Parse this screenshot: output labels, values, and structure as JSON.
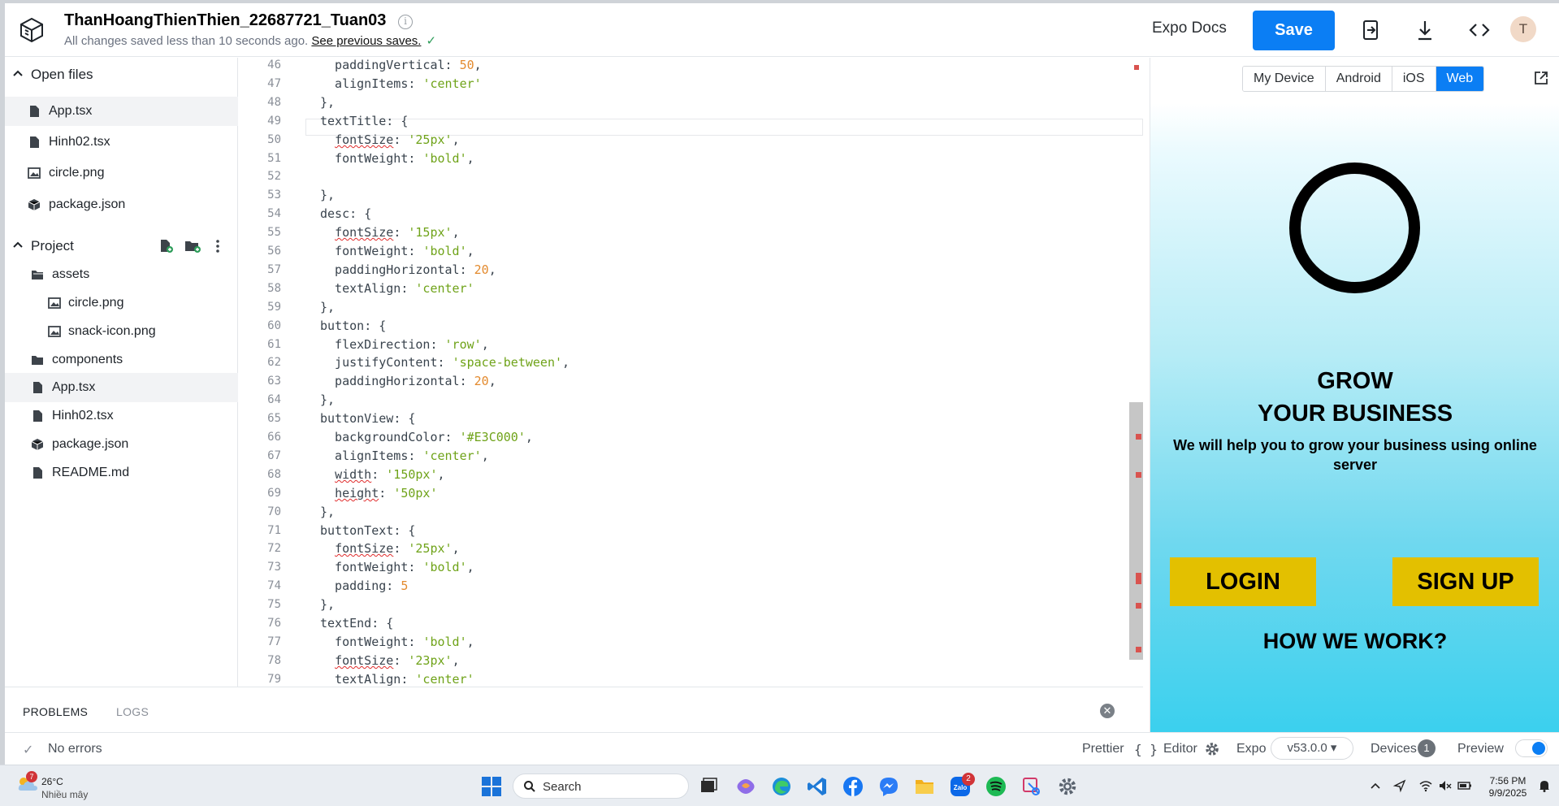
{
  "header": {
    "project_title": "ThanHoangThienThien_22687721_Tuan03",
    "saved_status": "All changes saved less than 10 seconds ago.",
    "previous_saves_link": "See previous saves.",
    "docs_label": "Expo Docs",
    "save_label": "Save",
    "avatar_initial": "T"
  },
  "sidebar": {
    "open_files_label": "Open files",
    "open_files": [
      {
        "name": "App.tsx",
        "icon": "file-icon",
        "active": true
      },
      {
        "name": "Hinh02.tsx",
        "icon": "file-icon"
      },
      {
        "name": "circle.png",
        "icon": "image-icon"
      },
      {
        "name": "package.json",
        "icon": "package-icon"
      }
    ],
    "project_label": "Project",
    "project_tree": [
      {
        "name": "assets",
        "icon": "folder-open-icon"
      },
      {
        "name": "circle.png",
        "icon": "image-icon"
      },
      {
        "name": "snack-icon.png",
        "icon": "image-icon"
      },
      {
        "name": "components",
        "icon": "folder-icon"
      },
      {
        "name": "App.tsx",
        "icon": "file-icon",
        "active": true
      },
      {
        "name": "Hinh02.tsx",
        "icon": "file-icon"
      },
      {
        "name": "package.json",
        "icon": "package-icon"
      },
      {
        "name": "README.md",
        "icon": "file-icon"
      }
    ]
  },
  "editor": {
    "lines": [
      {
        "n": "46",
        "k": "  paddingVertical",
        "v": "50",
        "t": "num",
        "e": ","
      },
      {
        "n": "47",
        "k": "  alignItems",
        "v": "'center'",
        "t": "str",
        "e": ""
      },
      {
        "n": "48",
        "k": "}",
        "v": "",
        "t": "",
        "e": ","
      },
      {
        "n": "49",
        "k": "textTitle",
        "v": "{",
        "t": "",
        "e": ""
      },
      {
        "n": "50",
        "k": "  fontSize",
        "v": "'25px'",
        "t": "str",
        "e": ",",
        "sq": true
      },
      {
        "n": "51",
        "k": "  fontWeight",
        "v": "'bold'",
        "t": "str",
        "e": ","
      },
      {
        "n": "52",
        "k": "",
        "v": "",
        "t": "",
        "e": ""
      },
      {
        "n": "53",
        "k": "}",
        "v": "",
        "t": "",
        "e": ","
      },
      {
        "n": "54",
        "k": "desc",
        "v": "{",
        "t": "",
        "e": ""
      },
      {
        "n": "55",
        "k": "  fontSize",
        "v": "'15px'",
        "t": "str",
        "e": ",",
        "sq": true
      },
      {
        "n": "56",
        "k": "  fontWeight",
        "v": "'bold'",
        "t": "str",
        "e": ","
      },
      {
        "n": "57",
        "k": "  paddingHorizontal",
        "v": "20",
        "t": "num",
        "e": ","
      },
      {
        "n": "58",
        "k": "  textAlign",
        "v": "'center'",
        "t": "str",
        "e": ""
      },
      {
        "n": "59",
        "k": "}",
        "v": "",
        "t": "",
        "e": ","
      },
      {
        "n": "60",
        "k": "button",
        "v": "{",
        "t": "",
        "e": ""
      },
      {
        "n": "61",
        "k": "  flexDirection",
        "v": "'row'",
        "t": "str",
        "e": ","
      },
      {
        "n": "62",
        "k": "  justifyContent",
        "v": "'space-between'",
        "t": "str",
        "e": ","
      },
      {
        "n": "63",
        "k": "  paddingHorizontal",
        "v": "20",
        "t": "num",
        "e": ","
      },
      {
        "n": "64",
        "k": "}",
        "v": "",
        "t": "",
        "e": ","
      },
      {
        "n": "65",
        "k": "buttonView",
        "v": "{",
        "t": "",
        "e": ""
      },
      {
        "n": "66",
        "k": "  backgroundColor",
        "v": "'#E3C000'",
        "t": "str",
        "e": ","
      },
      {
        "n": "67",
        "k": "  alignItems",
        "v": "'center'",
        "t": "str",
        "e": ","
      },
      {
        "n": "68",
        "k": "  width",
        "v": "'150px'",
        "t": "str",
        "e": ",",
        "sq": true
      },
      {
        "n": "69",
        "k": "  height",
        "v": "'50px'",
        "t": "str",
        "e": "",
        "sq": true
      },
      {
        "n": "70",
        "k": "}",
        "v": "",
        "t": "",
        "e": ","
      },
      {
        "n": "71",
        "k": "buttonText",
        "v": "{",
        "t": "",
        "e": ""
      },
      {
        "n": "72",
        "k": "  fontSize",
        "v": "'25px'",
        "t": "str",
        "e": ",",
        "sq": true
      },
      {
        "n": "73",
        "k": "  fontWeight",
        "v": "'bold'",
        "t": "str",
        "e": ","
      },
      {
        "n": "74",
        "k": "  padding",
        "v": "5",
        "t": "num",
        "e": ""
      },
      {
        "n": "75",
        "k": "}",
        "v": "",
        "t": "",
        "e": ","
      },
      {
        "n": "76",
        "k": "textEnd",
        "v": "{",
        "t": "",
        "e": ""
      },
      {
        "n": "77",
        "k": "  fontWeight",
        "v": "'bold'",
        "t": "str",
        "e": ","
      },
      {
        "n": "78",
        "k": "  fontSize",
        "v": "'23px'",
        "t": "str",
        "e": ",",
        "sq": true
      },
      {
        "n": "79",
        "k": "  textAlign",
        "v": "'center'",
        "t": "str",
        "e": ""
      }
    ]
  },
  "panel": {
    "problems_tab": "PROBLEMS",
    "logs_tab": "LOGS"
  },
  "statusbar": {
    "errors": "No errors",
    "prettier": "Prettier",
    "prettier_icon": "{ }",
    "editor": "Editor",
    "expo": "Expo",
    "sdk_version": "v53.0.0 ▾",
    "devices": "Devices",
    "devices_count": "1",
    "preview": "Preview"
  },
  "preview": {
    "tabs": [
      "My Device",
      "Android",
      "iOS",
      "Web"
    ],
    "selected_tab": "Web",
    "app": {
      "title_line1": "GROW",
      "title_line2": "YOUR BUSINESS",
      "description": "We will help you to grow your business using online server",
      "login": "LOGIN",
      "signup": "SIGN UP",
      "how": "HOW WE WORK?",
      "button_color": "#E3C000"
    }
  },
  "taskbar": {
    "weather_badge": "7",
    "temperature": "26°C",
    "weather_desc": "Nhiều mây",
    "search_label": "Search",
    "zalo_badge": "2",
    "time": "7:56 PM",
    "date": "9/9/2025"
  },
  "colors": {
    "accent": "#0b7ef4",
    "string": "#6fa319",
    "number": "#e38a2e",
    "gutter": "#8a8f98"
  }
}
